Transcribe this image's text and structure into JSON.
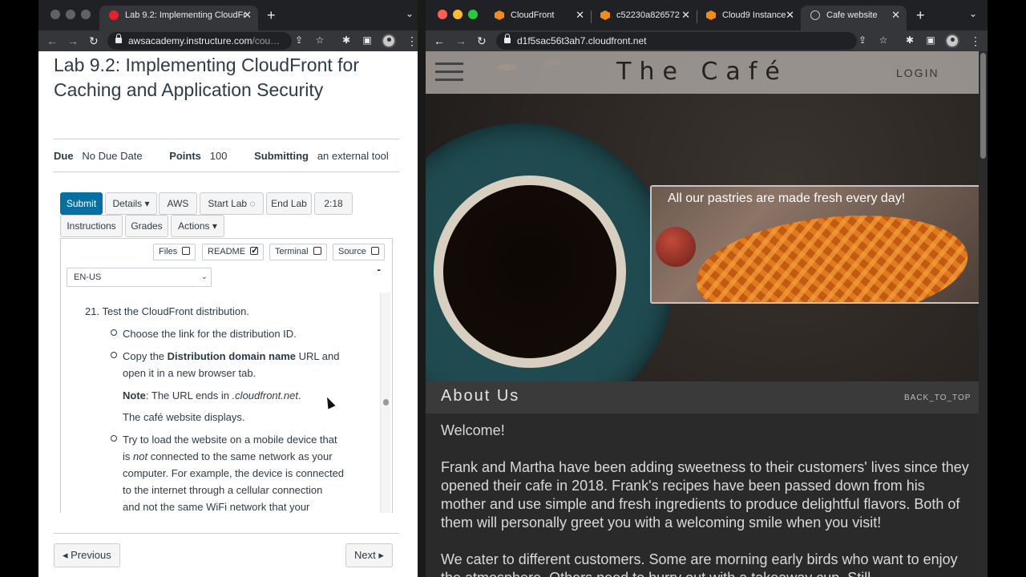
{
  "left_window": {
    "tabs": [
      {
        "title": "Lab 9.2: Implementing CloudFr",
        "close": "✕"
      }
    ],
    "new_tab": "+",
    "tab_chevron": "⌄",
    "url_host": "awsacademy.instructure.com",
    "url_path": "/cou…",
    "page": {
      "title": "Lab 9.2: Implementing CloudFront for Caching and Application Security",
      "due_label": "Due",
      "due_value": "No Due Date",
      "points_label": "Points",
      "points_value": "100",
      "submitting_label": "Submitting",
      "submitting_value": "an external tool",
      "buttons": {
        "submit": "Submit",
        "details": "Details ▾",
        "aws": "AWS",
        "start_lab": "Start Lab ◌",
        "end_lab": "End Lab",
        "timer": "2:18",
        "instructions": "Instructions",
        "grades": "Grades",
        "actions": "Actions ▾"
      },
      "toggles": [
        {
          "label": "Files",
          "checked": false
        },
        {
          "label": "README",
          "checked": true
        },
        {
          "label": "Terminal",
          "checked": false
        },
        {
          "label": "Source",
          "checked": false
        }
      ],
      "language_select": "EN-US",
      "collapse": "-",
      "step": "21. Test the CloudFront distribution.",
      "bullets": {
        "b1": "Choose the link for the distribution ID.",
        "b2_pre": "Copy the ",
        "b2_bold": "Distribution domain name",
        "b2_post": " URL and",
        "b2_line2": "open it in a new browser tab.",
        "note_bold": "Note",
        "note_pre": ": The URL ends in ",
        "note_em": ".cloudfront.net",
        "note_post": ".",
        "displays": "The café website displays.",
        "b3_l1": "Try to load the website on a mobile device that",
        "b3_l2_pre": "is ",
        "b3_l2_em": "not",
        "b3_l2_post": " connected to the same network as your",
        "b3_l3": "computer. For example, the device is connected",
        "b3_l4": "to the internet through a cellular connection",
        "b3_l5": "and not the same WiFi network that your"
      },
      "previous": "◂ Previous",
      "next": "Next ▸"
    }
  },
  "right_window": {
    "tabs": [
      {
        "title": "CloudFront",
        "close": "✕"
      },
      {
        "title": "c52230a826572",
        "close": "✕"
      },
      {
        "title": "Cloud9 Instance",
        "close": "✕"
      },
      {
        "title": "Cafe website",
        "close": "✕"
      }
    ],
    "new_tab": "+",
    "tab_chevron": "⌄",
    "url": "d1f5sac56t3ah7.cloudfront.net",
    "site": {
      "logo": "The Café",
      "login": "LOGIN",
      "promo": "All our pastries are made fresh every day!",
      "about_title": "About Us",
      "back_to_top": "BACK_TO_TOP",
      "welcome": "Welcome!",
      "para1": "Frank and Martha have been adding sweetness to their customers' lives since they opened their cafe in 2018. Frank's recipes have been passed down from his mother and use simple and fresh ingredients to produce delightful flavors. Both of them will personally greet you with a welcoming smile when you visit!",
      "para2": "We cater to different customers. Some are morning early birds who want to enjoy the atmosphere. Others need to hurry out with a takeaway cup. Still"
    }
  },
  "colors": {
    "chrome_dark": "#202124",
    "chrome_toolbar": "#35363a",
    "canvas_blue": "#0770a3",
    "cafe_dark": "#2a2a2a",
    "aws_orange": "#f08c1e"
  }
}
